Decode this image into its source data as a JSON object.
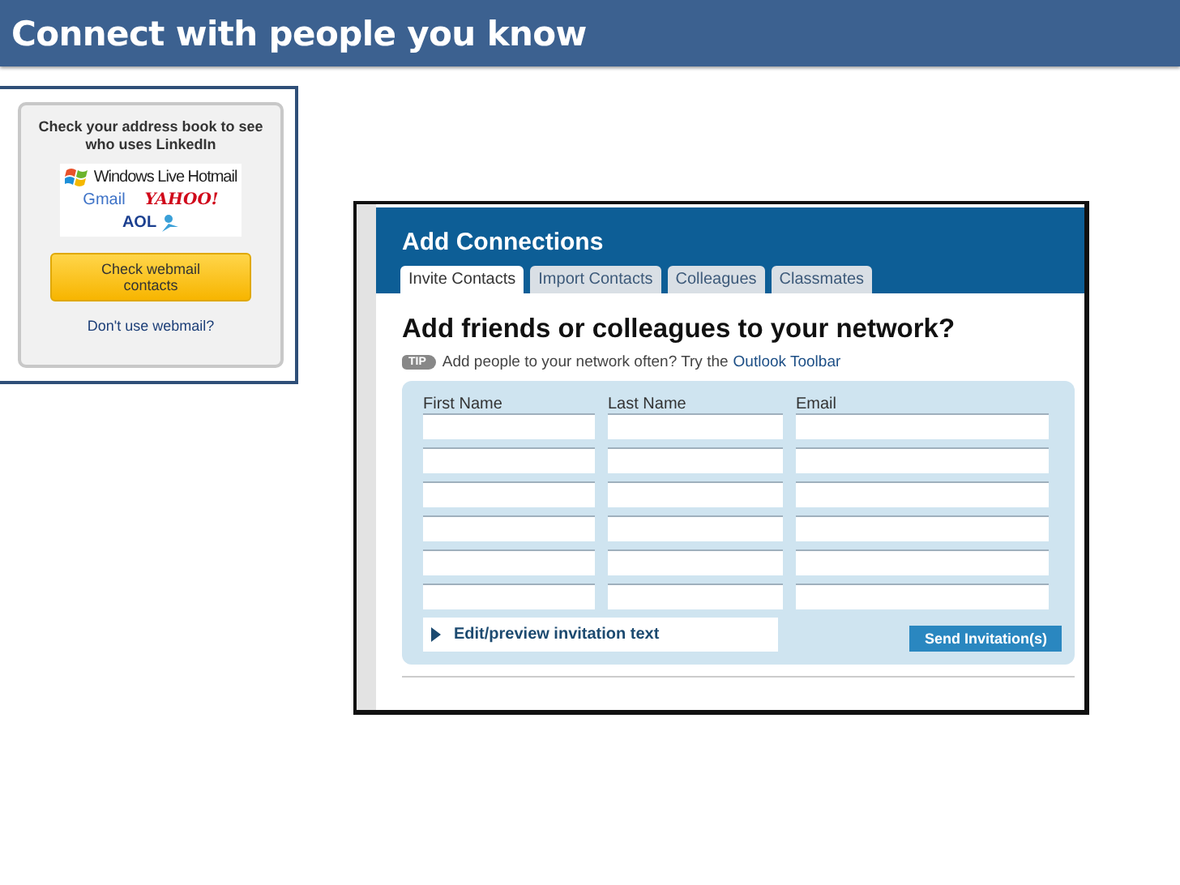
{
  "slide": {
    "title": "Connect with people you know"
  },
  "webmail_box": {
    "prompt": "Check your address book to see who uses LinkedIn",
    "logos": [
      {
        "kind": "hotmail",
        "text": "Windows Live Hotmail"
      },
      {
        "kind": "gmail",
        "text": "Gmail"
      },
      {
        "kind": "yahoo",
        "text": "YAHOO!"
      },
      {
        "kind": "aol",
        "text": "AOL"
      }
    ],
    "button": "Check webmail contacts",
    "link": "Don't use webmail?"
  },
  "add_connections": {
    "title": "Add Connections",
    "tabs": [
      {
        "label": "Invite Contacts",
        "selected": true
      },
      {
        "label": "Import Contacts",
        "selected": false
      },
      {
        "label": "Colleagues",
        "selected": false
      },
      {
        "label": "Classmates",
        "selected": false
      }
    ],
    "heading": "Add friends or colleagues to your network?",
    "tip": {
      "badge": "TIP",
      "text": "Add people to your network often? Try the",
      "link": "Outlook Toolbar"
    },
    "columns": [
      "First Name",
      "Last Name",
      "Email"
    ],
    "rows": [
      {
        "kind": "blank"
      },
      {
        "kind": "blank"
      },
      {
        "kind": "blank"
      },
      {
        "kind": "blank"
      },
      {
        "kind": "blank"
      },
      {
        "kind": "blank"
      }
    ],
    "edit_link": "Edit/preview invitation text",
    "send_button": "Send Invitation(s)"
  }
}
